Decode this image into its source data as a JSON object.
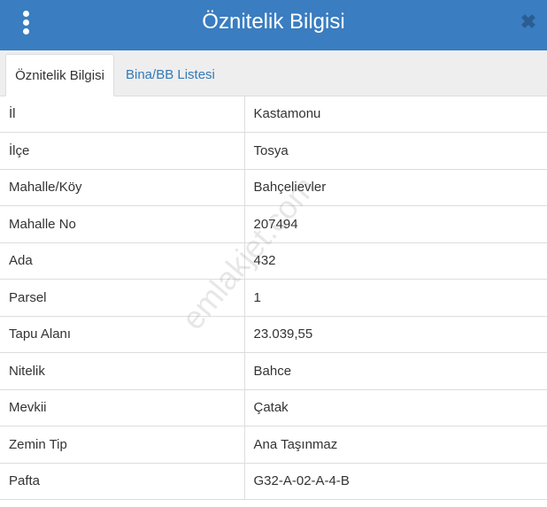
{
  "window": {
    "title": "Öznitelik Bilgisi"
  },
  "tabs": [
    {
      "label": "Öznitelik Bilgisi"
    },
    {
      "label": "Bina/BB Listesi"
    }
  ],
  "rows": [
    {
      "key": "İl",
      "value": "Kastamonu"
    },
    {
      "key": "İlçe",
      "value": "Tosya"
    },
    {
      "key": "Mahalle/Köy",
      "value": "Bahçelievler"
    },
    {
      "key": "Mahalle No",
      "value": "207494"
    },
    {
      "key": "Ada",
      "value": "432"
    },
    {
      "key": "Parsel",
      "value": "1"
    },
    {
      "key": "Tapu Alanı",
      "value": "23.039,55"
    },
    {
      "key": "Nitelik",
      "value": "Bahce"
    },
    {
      "key": "Mevkii",
      "value": "Çatak"
    },
    {
      "key": "Zemin Tip",
      "value": "Ana Taşınmaz"
    },
    {
      "key": "Pafta",
      "value": "G32-A-02-A-4-B"
    }
  ],
  "watermark": "emlakjet.com",
  "icons": {
    "menu": "vertical-ellipsis-icon",
    "close": "close-icon"
  },
  "colors": {
    "header": "#3a7dc0",
    "link": "#337ab7"
  }
}
